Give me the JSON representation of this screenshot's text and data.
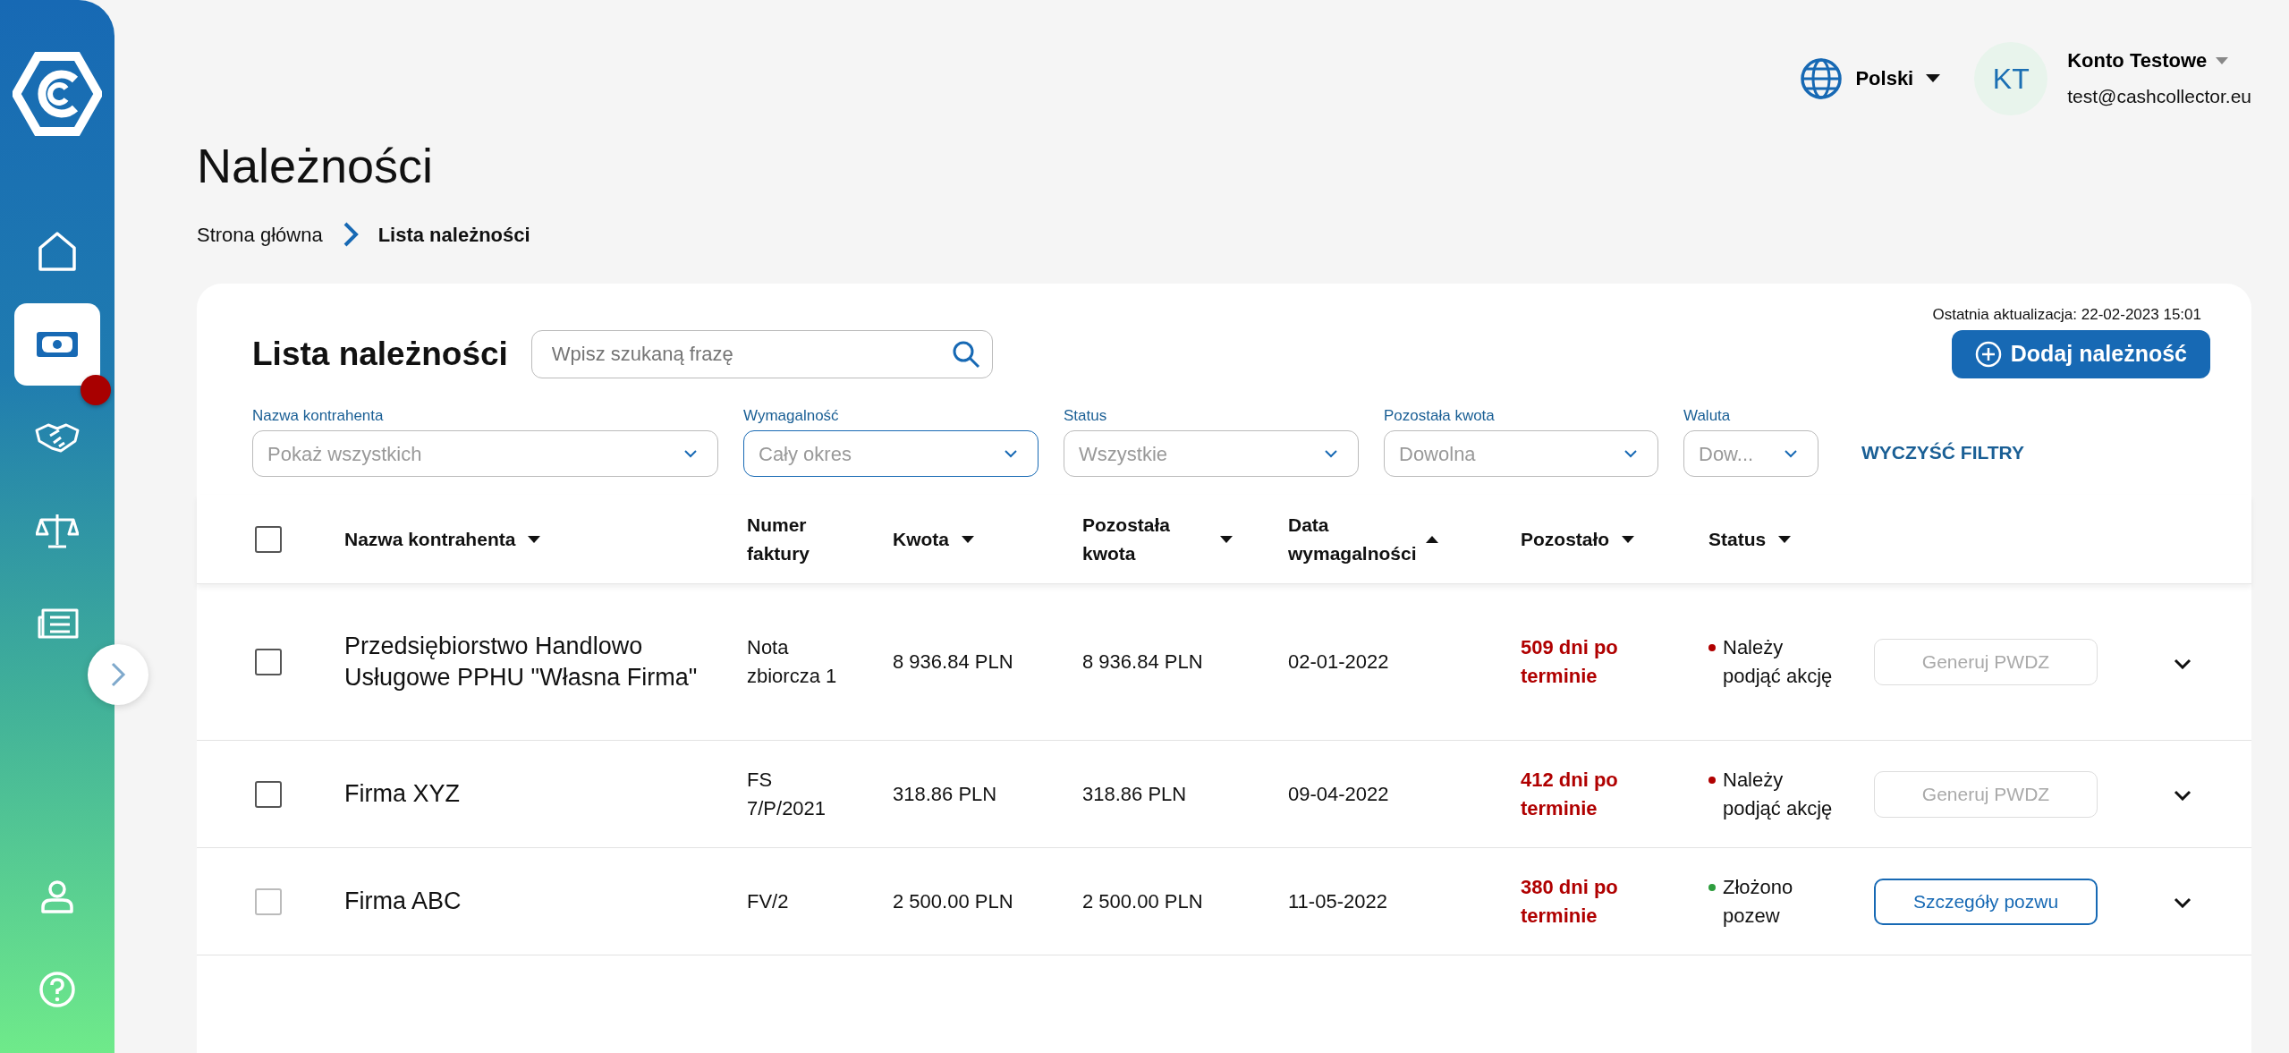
{
  "sidebar": {
    "items": [
      {
        "selected": false,
        "notification": false
      },
      {
        "selected": true,
        "notification": true
      },
      {
        "selected": false,
        "notification": false
      },
      {
        "selected": false,
        "notification": false
      },
      {
        "selected": false,
        "notification": false
      }
    ],
    "bottom_items": [
      {
        "selected": false
      },
      {
        "selected": false
      }
    ]
  },
  "header": {
    "language": "Polski",
    "user": {
      "initials": "KT",
      "name": "Konto Testowe",
      "email": "test@cashcollector.eu"
    }
  },
  "page": {
    "title": "Należności",
    "breadcrumb": [
      {
        "label": "Strona główna",
        "current": false
      },
      {
        "label": "Lista należności",
        "current": true
      }
    ]
  },
  "card": {
    "last_update": "Ostatnia aktualizacja: 22-02-2023 15:01",
    "title": "Lista należności",
    "search": {
      "placeholder": "Wpisz szukaną frazę"
    },
    "add_button": "Dodaj należność",
    "filters": [
      {
        "label": "Nazwa kontrahenta",
        "placeholder": "Pokaż wszystkich",
        "active": false
      },
      {
        "label": "Wymagalność",
        "placeholder": "Cały okres",
        "active": true
      },
      {
        "label": "Status",
        "placeholder": "Wszystkie",
        "active": false
      },
      {
        "label": "Pozostała kwota",
        "placeholder": "Dowolna",
        "active": false
      },
      {
        "label": "Waluta",
        "placeholder": "Dow...",
        "active": false
      }
    ],
    "clear_filters": "WYCZYŚĆ FILTRY",
    "table": {
      "columns": [
        {
          "label": "Nazwa kontrahenta",
          "ascending": false
        },
        {
          "label": "Numer faktury"
        },
        {
          "label": "Kwota",
          "ascending": false
        },
        {
          "label": "Pozostała kwota",
          "ascending": false
        },
        {
          "label": "Data wymagalności",
          "ascending": true
        },
        {
          "label": "Pozostało",
          "ascending": false
        },
        {
          "label": "Status",
          "ascending": false
        }
      ],
      "select_all": {
        "checked": false
      },
      "rows": [
        {
          "checked": false,
          "disabled": false,
          "name": "Przedsiębiorstwo Handlowo Usługowe PPHU \"Własna Firma\"",
          "invoice": "Nota zbiorcza 1",
          "amount": "8 936.84 PLN",
          "remaining_amount": "8 936.84 PLN",
          "due_date": "02-01-2022",
          "overdue": "509 dni po terminie",
          "status": "Należy podjąć akcję",
          "color": "#b00000",
          "action": {
            "label": "Generuj PWDZ",
            "disabled": true
          }
        },
        {
          "checked": false,
          "disabled": false,
          "name": "Firma XYZ",
          "invoice": "FS 7/P/2021",
          "amount": "318.86 PLN",
          "remaining_amount": "318.86 PLN",
          "due_date": "09-04-2022",
          "overdue": "412 dni po terminie",
          "status": "Należy podjąć akcję",
          "color": "#b00000",
          "action": {
            "label": "Generuj PWDZ",
            "disabled": true
          }
        },
        {
          "checked": false,
          "disabled": true,
          "name": "Firma ABC",
          "invoice": "FV/2",
          "amount": "2 500.00 PLN",
          "remaining_amount": "2 500.00 PLN",
          "due_date": "11-05-2022",
          "overdue": "380 dni po terminie",
          "status": "Złożono pozew",
          "color": "#2e9d3e",
          "action": {
            "label": "Szczegóły pozwu",
            "disabled": false
          }
        }
      ]
    }
  }
}
